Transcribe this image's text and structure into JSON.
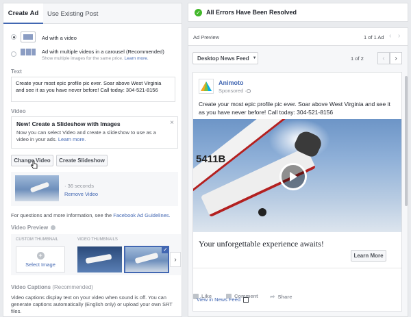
{
  "left": {
    "tabs": [
      {
        "label": "Create Ad",
        "active": true
      },
      {
        "label": "Use Existing Post",
        "active": false
      }
    ],
    "format_options": [
      {
        "label": "Ad with a video",
        "sub": "",
        "selected": true
      },
      {
        "label": "Ad with multiple videos in a carousel",
        "suffix": " (Recommended)",
        "sub": "Show multiple images for the same price.",
        "sub_link": "Learn more.",
        "selected": false
      }
    ],
    "text_section": {
      "label": "Text",
      "value": "Create your most epic profile pic ever. Soar above West Virginia and see it as you have never before! Call today: 304-521-8156"
    },
    "video_section": {
      "label": "Video",
      "notice_title": "New! Create a Slideshow with Images",
      "notice_body": "Now you can select Video and create a slideshow to use as a video in your ads.",
      "notice_link": "Learn more.",
      "notice_close": "×",
      "change_video": "Change Video",
      "create_slideshow": "Create Slideshow",
      "duration": "· 36 seconds",
      "remove_video": "Remove Video"
    },
    "guidelines": {
      "text": "For questions and more information, see the ",
      "link": "Facebook Ad Guidelines."
    },
    "video_preview": {
      "label": "Video Preview",
      "custom_thumb_label": "CUSTOM THUMBNAIL",
      "video_thumbs_label": "VIDEO THUMBNAILS",
      "select_image": "Select Image",
      "plus": "+"
    },
    "captions": {
      "label": "Video Captions",
      "suffix": " (Recommended)",
      "body": "Video captions display text on your video when sound is off. You can generate captions automatically (English only) or upload your own SRT files."
    }
  },
  "right": {
    "banner": "All Errors Have Been Resolved",
    "ad_preview": {
      "title": "Ad Preview",
      "count": "1 of 1 Ad",
      "placement": "Desktop News Feed",
      "page": "1 of 2"
    },
    "post": {
      "page_name": "Animoto",
      "sponsored": "Sponsored · ",
      "text": "Create your most epic profile pic ever. Soar above West Virginia and see it as you have never before! Call today: 304-521-8156",
      "tail_number": "5411B",
      "headline": "Your unforgettable experience awaits!",
      "cta": "Learn More",
      "actions": [
        "Like",
        "Comment",
        "Share"
      ]
    },
    "view_in_feed": "View in News Feed"
  },
  "colors": {
    "accent": "#4267b2",
    "success": "#42b72a",
    "border": "#dddfe2",
    "bg": "#e9ebee"
  }
}
